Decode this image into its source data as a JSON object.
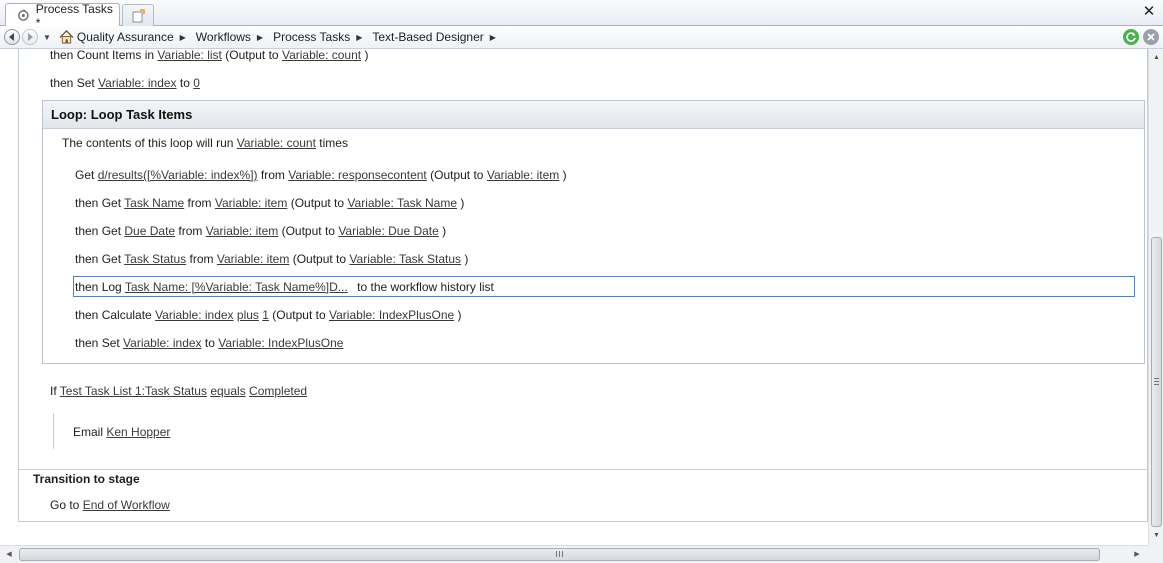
{
  "tabs": {
    "active_label": "Process Tasks *"
  },
  "breadcrumb": [
    {
      "label": "Quality Assurance"
    },
    {
      "label": "Workflows"
    },
    {
      "label": "Process Tasks"
    },
    {
      "label": "Text-Based Designer"
    }
  ],
  "steps_before": {
    "count": {
      "prefix": "then Count Items in",
      "list": "Variable: list",
      "mid": "(Output to",
      "output": "Variable: count",
      "suffix": ")"
    },
    "set_index": {
      "prefix": "then Set",
      "var": "Variable: index",
      "mid": "to",
      "value": "0"
    }
  },
  "loop": {
    "title": "Loop: Loop Task Items",
    "desc_prefix": "The contents of this loop will run",
    "desc_var": "Variable: count",
    "desc_suffix": "times",
    "get_item": {
      "prefix": "Get",
      "path": "d/results([%Variable: index%])",
      "from": "from",
      "source": "Variable: responsecontent",
      "output_lbl": "(Output to",
      "output": "Variable: item",
      "close": ")"
    },
    "get_name": {
      "prefix": "then Get",
      "field": "Task Name",
      "from": "from",
      "source": "Variable: item",
      "output_lbl": "(Output to",
      "output": "Variable: Task Name",
      "close": ")"
    },
    "get_due": {
      "prefix": "then Get",
      "field": "Due Date",
      "from": "from",
      "source": "Variable: item",
      "output_lbl": "(Output to",
      "output": "Variable: Due Date",
      "close": ")"
    },
    "get_status": {
      "prefix": "then Get",
      "field": "Task Status",
      "from": "from",
      "source": "Variable: item",
      "output_lbl": "(Output to",
      "output": "Variable: Task Status",
      "close": ")"
    },
    "log": {
      "prefix": "then Log",
      "message": "Task Name: [%Variable: Task Name%]D...",
      "suffix": "to the workflow history list"
    },
    "calc": {
      "prefix": "then Calculate",
      "var": "Variable: index",
      "op": "plus",
      "value": "1",
      "output_lbl": "(Output to",
      "output": "Variable: IndexPlusOne",
      "close": ")"
    },
    "set": {
      "prefix": "then Set",
      "var": "Variable: index",
      "mid": "to",
      "value": "Variable: IndexPlusOne"
    }
  },
  "condition": {
    "prefix": "If",
    "field": "Test Task List 1:Task Status",
    "op": "equals",
    "value": "Completed"
  },
  "email": {
    "prefix": "Email",
    "to": "Ken Hopper"
  },
  "transition": {
    "title": "Transition to stage",
    "prefix": "Go to",
    "target": "End of Workflow"
  },
  "colors": {
    "accent": "#5a7fb5",
    "refresh_green": "#4caf50",
    "stop_gray": "#9aa1aa"
  },
  "icons": {
    "tab": "workflow-tab-icon",
    "new_tab": "new-tab-icon",
    "home": "home-icon",
    "back": "back-arrow-icon",
    "forward": "forward-arrow-icon",
    "refresh": "refresh-icon",
    "stop": "stop-icon"
  }
}
